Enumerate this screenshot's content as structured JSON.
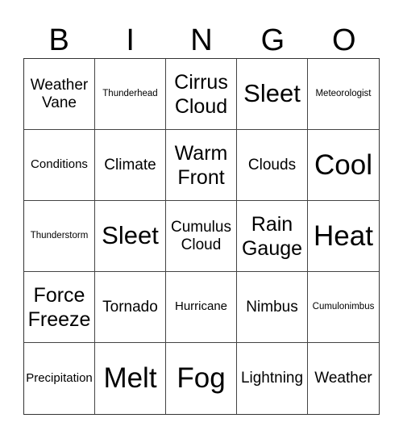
{
  "header": {
    "letters": [
      "B",
      "I",
      "N",
      "G",
      "O"
    ]
  },
  "grid": {
    "rows": [
      [
        "Weather Vane",
        "Thunderhead",
        "Cirrus Cloud",
        "Sleet",
        "Meteorologist"
      ],
      [
        "Conditions",
        "Climate",
        "Warm Front",
        "Clouds",
        "Cool"
      ],
      [
        "Thunderstorm",
        "Sleet",
        "Cumulus Cloud",
        "Rain Gauge",
        "Heat"
      ],
      [
        "Force Freeze",
        "Tornado",
        "Hurricane",
        "Nimbus",
        "Cumulonimbus"
      ],
      [
        "Precipitation",
        "Melt",
        "Fog",
        "Lightning",
        "Weather"
      ]
    ]
  },
  "colors": {
    "grid_line": "#444444",
    "text": "#000000",
    "background": "#ffffff"
  }
}
